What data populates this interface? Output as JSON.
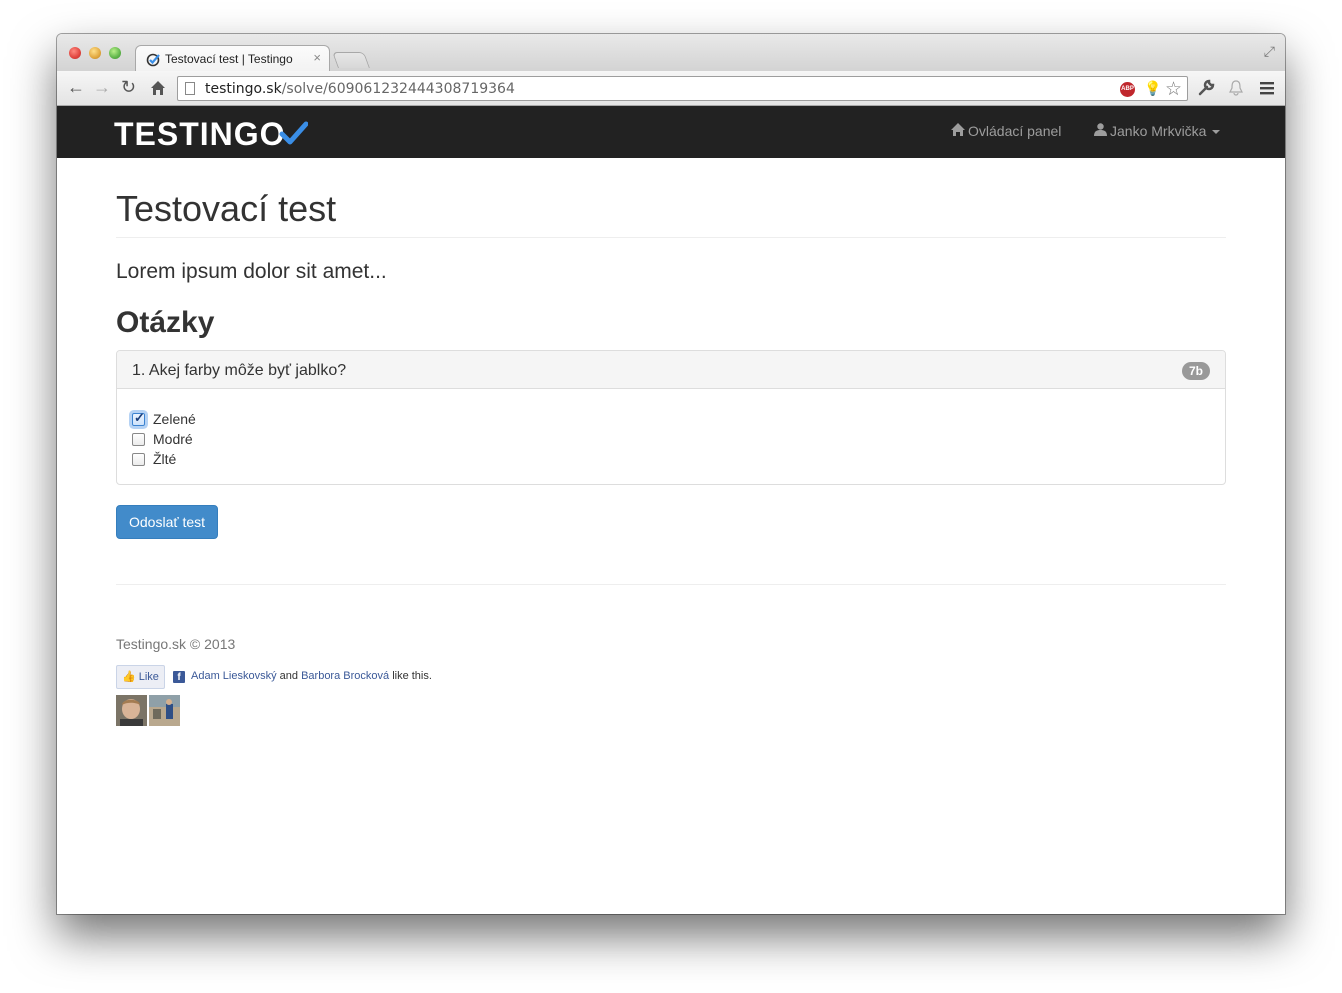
{
  "browser": {
    "tab_title": "Testovací test | Testingo",
    "tab_close": "×",
    "url_domain": "testingo.sk",
    "url_path": "/solve/609061232444308719364",
    "abp_label": "ABP"
  },
  "navbar": {
    "brand": "TESTINGO",
    "dashboard_label": "Ovládací panel",
    "user_label": "Janko Mrkvička"
  },
  "page": {
    "title": "Testovací test",
    "description": "Lorem ipsum dolor sit amet...",
    "questions_heading": "Otázky"
  },
  "question": {
    "text": "1. Akej farby môže byť jablko?",
    "points": "7b",
    "options": [
      {
        "label": "Zelené",
        "checked": true
      },
      {
        "label": "Modré",
        "checked": false
      },
      {
        "label": "Žlté",
        "checked": false
      }
    ]
  },
  "submit_label": "Odoslať test",
  "footer": {
    "copyright": "Testingo.sk © 2013",
    "like_label": "Like",
    "friend1": "Adam Lieskovský",
    "and": "and",
    "friend2": "Barbora Brocková",
    "like_suffix": "like this."
  },
  "colors": {
    "navbar": "#222222",
    "primary": "#428bca",
    "brand_check": "#3a8ee6"
  }
}
